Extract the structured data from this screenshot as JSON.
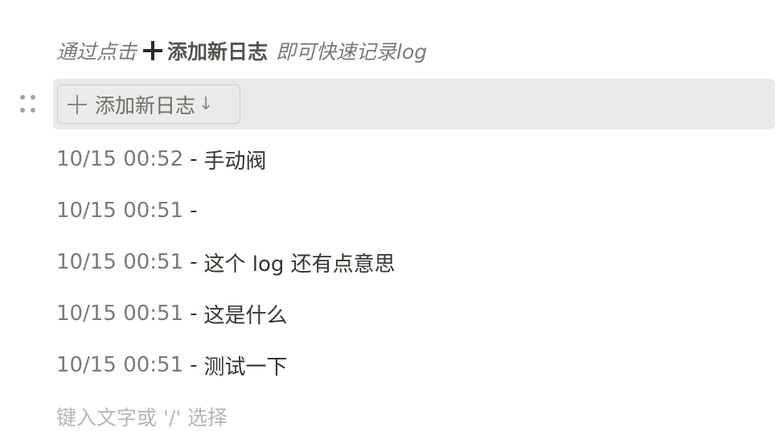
{
  "hint": {
    "prefix": "通过点击",
    "bold_label": "添加新日志",
    "suffix": "即可快速记录log"
  },
  "template_button": {
    "label": "添加新日志",
    "arrow": "↓"
  },
  "log_entries": [
    {
      "timestamp": "10/15 00:52",
      "separator": "-",
      "message": "手动阀"
    },
    {
      "timestamp": "10/15 00:51",
      "separator": "-",
      "message": ""
    },
    {
      "timestamp": "10/15 00:51",
      "separator": "-",
      "message": "这个 log 还有点意思"
    },
    {
      "timestamp": "10/15 00:51",
      "separator": "-",
      "message": "这是什么"
    },
    {
      "timestamp": "10/15 00:51",
      "separator": "-",
      "message": "测试一下"
    }
  ],
  "editor": {
    "placeholder": "键入文字或 '/' 选择"
  },
  "colors": {
    "block_highlight": "#ebeaea",
    "muted_text": "#7d7a75",
    "body_text": "#37352f"
  }
}
